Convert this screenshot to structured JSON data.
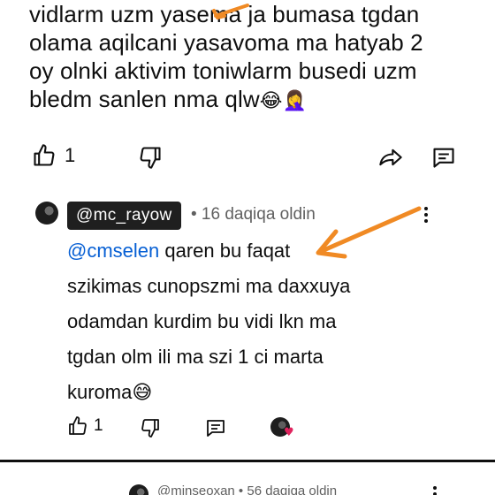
{
  "comment": {
    "text_lines": [
      "vidlarm uzm yasema ja bumasa tgdan",
      "olama aqilcani yasavoma ma hatyab 2",
      "oy olnki aktivim toniwlarm busedi uzm",
      "bledm sanlen nma qlw"
    ],
    "emojis": "😂🤦‍♀️",
    "like_count": "1"
  },
  "reply": {
    "handle": "@mc_rayow",
    "meta": "• 16 daqiqa oldin",
    "mention": "@cmselen",
    "text_lines": [
      " qaren bu faqat",
      "szikimas cunopszmi ma daxxuya",
      "odamdan kurdim bu vidi lkn ma",
      "tgdan olm ili ma szi 1 ci marta",
      "kuroma"
    ],
    "emoji": "😅",
    "like_count": "1"
  },
  "next_comment": {
    "meta": "@minseoxan • 56 daqiqa oldin"
  },
  "colors": {
    "text": "#0f0f0f",
    "meta": "#606060",
    "mention": "#065fd4",
    "handle_chip": "#1f1f1f",
    "annotation_arrow": "#f08a24",
    "heart": "#e0245e"
  }
}
